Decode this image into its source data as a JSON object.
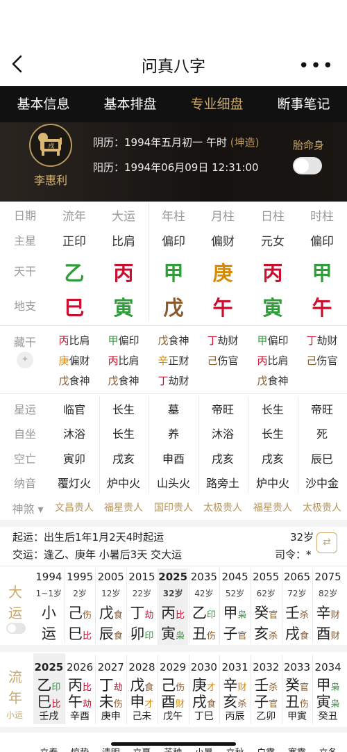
{
  "nav": {
    "title": "问真八字",
    "more": "•••"
  },
  "tabs": [
    "基本信息",
    "基本排盘",
    "专业细盘",
    "断事笔记"
  ],
  "person": {
    "name": "李惠利",
    "lunar_prefix": "阴历：1994年五月初一 午时",
    "lunar_gender": "(坤造)",
    "solar": "阳历：1994年06月09日 12:31:00",
    "tai_label": "胎命身"
  },
  "table": {
    "row_labels": [
      "日期",
      "主星",
      "天干",
      "地支"
    ],
    "dates": [
      "流年",
      "大运",
      "年柱",
      "月柱",
      "日柱",
      "时柱"
    ],
    "stars": [
      "正印",
      "比肩",
      "偏印",
      "偏财",
      "元女",
      "偏印"
    ],
    "stems": [
      "乙",
      "丙",
      "甲",
      "庚",
      "丙",
      "甲"
    ],
    "stem_colors": [
      "green",
      "red",
      "green",
      "orange",
      "red",
      "green"
    ],
    "branches": [
      "巳",
      "寅",
      "戊",
      "午",
      "寅",
      "午"
    ],
    "branch_colors": [
      "red",
      "green",
      "brown",
      "red",
      "green",
      "red"
    ]
  },
  "canggan": {
    "label": "藏干",
    "cols": [
      [
        [
          "丙",
          "比肩",
          "red"
        ],
        [
          "庚",
          "偏财",
          "orange"
        ],
        [
          "戊",
          "食神",
          "brown"
        ]
      ],
      [
        [
          "甲",
          "偏印",
          "green"
        ],
        [
          "丙",
          "比肩",
          "red"
        ],
        [
          "戊",
          "食神",
          "brown"
        ]
      ],
      [
        [
          "戊",
          "食神",
          "brown"
        ],
        [
          "辛",
          "正财",
          "orange"
        ],
        [
          "丁",
          "劫财",
          "red"
        ]
      ],
      [
        [
          "丁",
          "劫财",
          "red"
        ],
        [
          "己",
          "伤官",
          "brown"
        ]
      ],
      [
        [
          "甲",
          "偏印",
          "green"
        ],
        [
          "丙",
          "比肩",
          "red"
        ],
        [
          "戊",
          "食神",
          "brown"
        ]
      ],
      [
        [
          "丁",
          "劫财",
          "red"
        ],
        [
          "己",
          "伤官",
          "brown"
        ]
      ]
    ]
  },
  "info_rows": [
    {
      "label": "星运",
      "vals": [
        "临官",
        "长生",
        "墓",
        "帝旺",
        "长生",
        "帝旺"
      ]
    },
    {
      "label": "自坐",
      "vals": [
        "沐浴",
        "长生",
        "养",
        "沐浴",
        "长生",
        "死"
      ]
    },
    {
      "label": "空亡",
      "vals": [
        "寅卯",
        "戌亥",
        "申酉",
        "戌亥",
        "戌亥",
        "辰巳"
      ]
    },
    {
      "label": "纳音",
      "vals": [
        "覆灯火",
        "炉中火",
        "山头火",
        "路旁土",
        "炉中火",
        "沙中金"
      ]
    }
  ],
  "shensha": {
    "label": "神煞",
    "vals": [
      "文昌贵人",
      "福星贵人",
      "国印贵人",
      "太极贵人",
      "福星贵人",
      "太极贵人"
    ]
  },
  "qiyun": {
    "line1": "起运：出生后1年1月2天4时起运",
    "line2": "交运：逢乙、庚年 小暑后3天 交大运",
    "age": "32岁",
    "siling": "司令：*"
  },
  "dayun": {
    "label_top": "大",
    "label_bot": "运",
    "years": [
      "1994",
      "1995",
      "2005",
      "2015",
      "2025",
      "2035",
      "2045",
      "2055",
      "2065",
      "2075"
    ],
    "ages": [
      "1~1岁",
      "2岁",
      "12岁",
      "22岁",
      "32岁",
      "42岁",
      "52岁",
      "62岁",
      "72岁",
      "82岁"
    ],
    "first": [
      "小",
      "运"
    ],
    "stems": [
      [
        "己",
        "伤",
        "brown"
      ],
      [
        "戊",
        "食",
        "brown"
      ],
      [
        "丁",
        "劫",
        "red"
      ],
      [
        "丙",
        "比",
        "red"
      ],
      [
        "乙",
        "印",
        "green"
      ],
      [
        "甲",
        "枭",
        "green"
      ],
      [
        "癸",
        "官",
        "brown"
      ],
      [
        "壬",
        "杀",
        "brown"
      ],
      [
        "辛",
        "财",
        "brown"
      ]
    ],
    "branches": [
      [
        "巳",
        "比",
        "red"
      ],
      [
        "辰",
        "食",
        "brown"
      ],
      [
        "卯",
        "印",
        "green"
      ],
      [
        "寅",
        "枭",
        "green"
      ],
      [
        "丑",
        "伤",
        "brown"
      ],
      [
        "子",
        "官",
        "brown"
      ],
      [
        "亥",
        "杀",
        "brown"
      ],
      [
        "戌",
        "食",
        "brown"
      ],
      [
        "酉",
        "财",
        "brown"
      ]
    ]
  },
  "liunian": {
    "label_top": "流",
    "label_bot": "年",
    "label_small": "小运",
    "years": [
      "2025",
      "2026",
      "2027",
      "2028",
      "2029",
      "2030",
      "2031",
      "2032",
      "2033",
      "2034"
    ],
    "stems": [
      [
        "乙",
        "印",
        "green"
      ],
      [
        "丙",
        "比",
        "red"
      ],
      [
        "丁",
        "劫",
        "red"
      ],
      [
        "戊",
        "食",
        "brown"
      ],
      [
        "己",
        "伤",
        "brown"
      ],
      [
        "庚",
        "才",
        "orange"
      ],
      [
        "辛",
        "财",
        "orange"
      ],
      [
        "壬",
        "杀",
        "brown"
      ],
      [
        "癸",
        "官",
        "brown"
      ],
      [
        "甲",
        "枭",
        "green"
      ]
    ],
    "branches": [
      [
        "巳",
        "比",
        "red"
      ],
      [
        "午",
        "劫",
        "red"
      ],
      [
        "未",
        "伤",
        "brown"
      ],
      [
        "申",
        "才",
        "orange"
      ],
      [
        "酉",
        "财",
        "orange"
      ],
      [
        "戌",
        "食",
        "brown"
      ],
      [
        "亥",
        "杀",
        "brown"
      ],
      [
        "子",
        "官",
        "brown"
      ],
      [
        "丑",
        "伤",
        "brown"
      ],
      [
        "寅",
        "枭",
        "green"
      ]
    ],
    "xiaoyun": [
      "壬戌",
      "辛酉",
      "庚申",
      "己未",
      "戊午",
      "丁巳",
      "丙辰",
      "乙卯",
      "甲寅",
      "癸丑"
    ]
  },
  "bottom_partial": [
    "立春",
    "惊蛰",
    "清明",
    "立夏",
    "芒种",
    "小暑",
    "立秋",
    "白露",
    "寒露",
    "立冬"
  ]
}
